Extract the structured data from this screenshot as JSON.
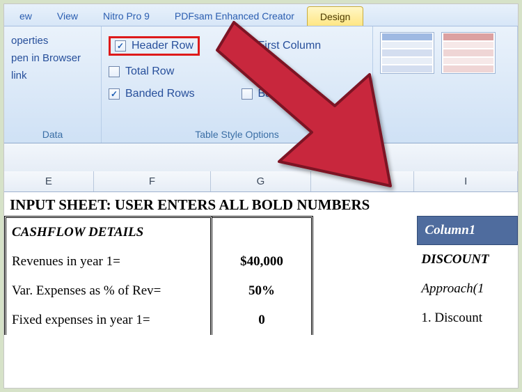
{
  "tabs": {
    "cut": "ew",
    "view": "View",
    "nitro": "Nitro Pro 9",
    "pdfsam": "PDFsam Enhanced Creator",
    "design": "Design"
  },
  "data_group": {
    "properties": "operties",
    "open_browser": "pen in Browser",
    "link": "link",
    "label": "Data"
  },
  "tso": {
    "header_row": "Header Row",
    "total_row": "Total Row",
    "banded_rows": "Banded Rows",
    "first_column": "First Column",
    "banded_cols": "Ban",
    "label": "Table Style Options"
  },
  "col_headers": {
    "E": "E",
    "F": "F",
    "G": "G",
    "H": "",
    "I": "I"
  },
  "sheet": {
    "title": "INPUT SHEET: USER ENTERS ALL BOLD NUMBERS",
    "cashflow_hdr": "CASHFLOW DETAILS",
    "rev_label": "Revenues in  year 1=",
    "rev_val": "$40,000",
    "var_label": "Var. Expenses as % of Rev=",
    "var_val": "50%",
    "fixed_label": "Fixed expenses in year 1=",
    "fixed_val": "0"
  },
  "right": {
    "col1": "Column1",
    "discount": "DISCOUNT",
    "approach": "Approach(1",
    "disc1": "1. Discount"
  }
}
